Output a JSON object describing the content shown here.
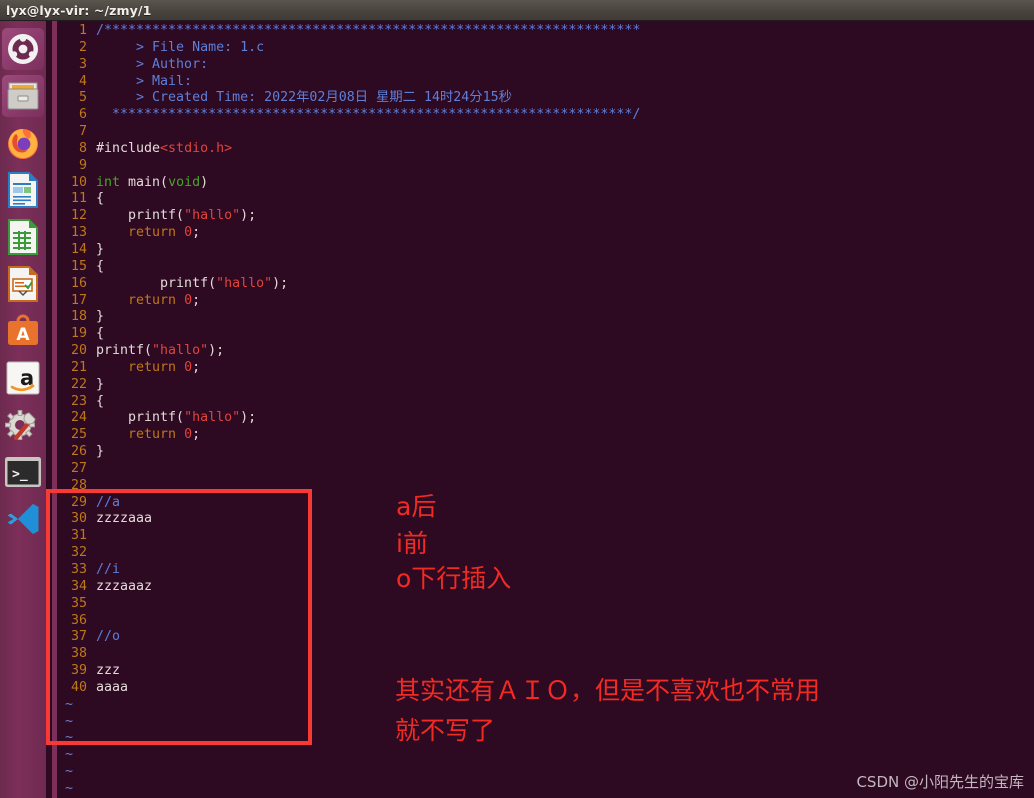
{
  "window": {
    "title": "lyx@lyx-vir: ~/zmy/1"
  },
  "launcher": {
    "items": [
      {
        "name": "ubuntu-dash-icon",
        "label": "Ubuntu Dash"
      },
      {
        "name": "files-icon",
        "label": "Files"
      },
      {
        "name": "firefox-icon",
        "label": "Firefox"
      },
      {
        "name": "libreoffice-writer-icon",
        "label": "LibreOffice Writer"
      },
      {
        "name": "libreoffice-calc-icon",
        "label": "LibreOffice Calc"
      },
      {
        "name": "libreoffice-impress-icon",
        "label": "LibreOffice Impress"
      },
      {
        "name": "ubuntu-software-icon",
        "label": "Ubuntu Software"
      },
      {
        "name": "amazon-icon",
        "label": "Amazon"
      },
      {
        "name": "system-settings-icon",
        "label": "System Settings"
      },
      {
        "name": "terminal-icon",
        "label": "Terminal"
      },
      {
        "name": "vscode-icon",
        "label": "Visual Studio Code"
      }
    ]
  },
  "editor": {
    "lines": [
      {
        "n": "1",
        "segments": [
          {
            "t": "/*******************************************************************",
            "c": "cmt"
          }
        ]
      },
      {
        "n": "2",
        "segments": [
          {
            "t": "     > File Name: 1.c",
            "c": "cmt"
          }
        ]
      },
      {
        "n": "3",
        "segments": [
          {
            "t": "     > Author:",
            "c": "cmt"
          }
        ]
      },
      {
        "n": "4",
        "segments": [
          {
            "t": "     > Mail:",
            "c": "cmt"
          }
        ]
      },
      {
        "n": "5",
        "segments": [
          {
            "t": "     > Created Time: 2022年02月08日 星期二 14时24分15秒",
            "c": "cmt"
          }
        ]
      },
      {
        "n": "6",
        "segments": [
          {
            "t": "  *****************************************************************/",
            "c": "cmt"
          }
        ]
      },
      {
        "n": "7",
        "segments": []
      },
      {
        "n": "8",
        "segments": [
          {
            "t": "#include",
            "c": "pre"
          },
          {
            "t": "<stdio.h>",
            "c": "inc"
          }
        ]
      },
      {
        "n": "9",
        "segments": []
      },
      {
        "n": "10",
        "segments": [
          {
            "t": "int",
            "c": "kw"
          },
          {
            "t": " main(",
            "c": "plain"
          },
          {
            "t": "void",
            "c": "kw"
          },
          {
            "t": ")",
            "c": "plain"
          }
        ]
      },
      {
        "n": "11",
        "segments": [
          {
            "t": "{",
            "c": "plain"
          }
        ]
      },
      {
        "n": "12",
        "segments": [
          {
            "t": "    printf(",
            "c": "plain"
          },
          {
            "t": "\"hallo\"",
            "c": "str"
          },
          {
            "t": ");",
            "c": "plain"
          }
        ]
      },
      {
        "n": "13",
        "segments": [
          {
            "t": "    ",
            "c": "plain"
          },
          {
            "t": "return",
            "c": "ret"
          },
          {
            "t": " ",
            "c": "plain"
          },
          {
            "t": "0",
            "c": "num0"
          },
          {
            "t": ";",
            "c": "plain"
          }
        ]
      },
      {
        "n": "14",
        "segments": [
          {
            "t": "}",
            "c": "plain"
          }
        ]
      },
      {
        "n": "15",
        "segments": [
          {
            "t": "{",
            "c": "plain"
          }
        ]
      },
      {
        "n": "16",
        "segments": [
          {
            "t": "        printf(",
            "c": "plain"
          },
          {
            "t": "\"hallo\"",
            "c": "str"
          },
          {
            "t": ");",
            "c": "plain"
          }
        ]
      },
      {
        "n": "17",
        "segments": [
          {
            "t": "    ",
            "c": "plain"
          },
          {
            "t": "return",
            "c": "ret"
          },
          {
            "t": " ",
            "c": "plain"
          },
          {
            "t": "0",
            "c": "num0"
          },
          {
            "t": ";",
            "c": "plain"
          }
        ]
      },
      {
        "n": "18",
        "segments": [
          {
            "t": "}",
            "c": "plain"
          }
        ]
      },
      {
        "n": "19",
        "segments": [
          {
            "t": "{",
            "c": "plain"
          }
        ]
      },
      {
        "n": "20",
        "segments": [
          {
            "t": "printf(",
            "c": "plain"
          },
          {
            "t": "\"hallo\"",
            "c": "str"
          },
          {
            "t": ");",
            "c": "plain"
          }
        ]
      },
      {
        "n": "21",
        "segments": [
          {
            "t": "    ",
            "c": "plain"
          },
          {
            "t": "return",
            "c": "ret"
          },
          {
            "t": " ",
            "c": "plain"
          },
          {
            "t": "0",
            "c": "num0"
          },
          {
            "t": ";",
            "c": "plain"
          }
        ]
      },
      {
        "n": "22",
        "segments": [
          {
            "t": "}",
            "c": "plain"
          }
        ]
      },
      {
        "n": "23",
        "segments": [
          {
            "t": "{",
            "c": "plain"
          }
        ]
      },
      {
        "n": "24",
        "segments": [
          {
            "t": "    printf(",
            "c": "plain"
          },
          {
            "t": "\"hallo\"",
            "c": "str"
          },
          {
            "t": ");",
            "c": "plain"
          }
        ]
      },
      {
        "n": "25",
        "segments": [
          {
            "t": "    ",
            "c": "plain"
          },
          {
            "t": "return",
            "c": "ret"
          },
          {
            "t": " ",
            "c": "plain"
          },
          {
            "t": "0",
            "c": "num0"
          },
          {
            "t": ";",
            "c": "plain"
          }
        ]
      },
      {
        "n": "26",
        "segments": [
          {
            "t": "}",
            "c": "plain"
          }
        ]
      },
      {
        "n": "27",
        "segments": []
      },
      {
        "n": "28",
        "segments": []
      },
      {
        "n": "29",
        "segments": [
          {
            "t": "//a",
            "c": "cmt"
          }
        ]
      },
      {
        "n": "30",
        "segments": [
          {
            "t": "zzzzaaa",
            "c": "plain"
          }
        ]
      },
      {
        "n": "31",
        "segments": []
      },
      {
        "n": "32",
        "segments": []
      },
      {
        "n": "33",
        "segments": [
          {
            "t": "//i",
            "c": "cmt"
          }
        ]
      },
      {
        "n": "34",
        "segments": [
          {
            "t": "zzzaaaz",
            "c": "plain"
          }
        ]
      },
      {
        "n": "35",
        "segments": []
      },
      {
        "n": "36",
        "segments": []
      },
      {
        "n": "37",
        "segments": [
          {
            "t": "//o",
            "c": "cmt"
          }
        ]
      },
      {
        "n": "38",
        "segments": []
      },
      {
        "n": "39",
        "segments": [
          {
            "t": "zzz",
            "c": "plain"
          }
        ]
      },
      {
        "n": "40",
        "segments": [
          {
            "t": "aaaa",
            "c": "plain"
          }
        ]
      }
    ],
    "empty_marker": "~",
    "empty_marker_count": 6
  },
  "annotations": {
    "a_line": "a后",
    "i_line": "i前",
    "o_line": "o下行插入",
    "note_line1": "其实还有ＡＩＯ，但是不喜欢也不常用",
    "note_line2": "就不写了",
    "color": "#f22a22",
    "box_color": "#f93a34"
  },
  "watermark": {
    "text": "CSDN @小阳先生的宝库"
  }
}
